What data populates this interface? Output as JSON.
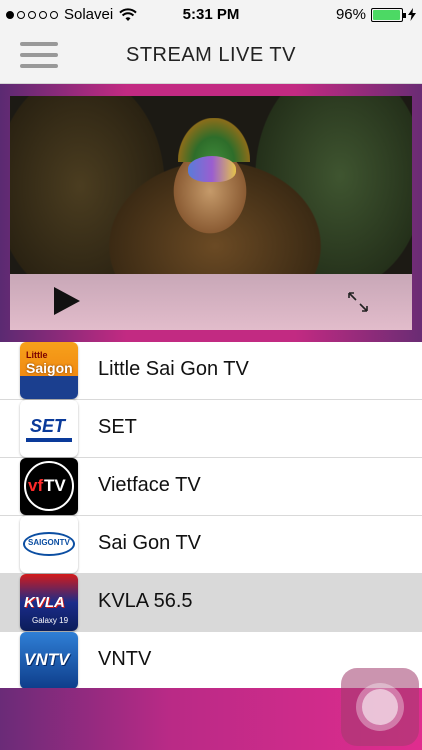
{
  "status_bar": {
    "carrier": "Solavei",
    "time": "5:31 PM",
    "battery": "96%",
    "battery_level": 0.96,
    "signal_bars_filled": 1,
    "signal_bars_total": 5
  },
  "nav": {
    "title": "STREAM LIVE TV",
    "menu_icon": "hamburger-menu-icon"
  },
  "player": {
    "play_icon": "play-icon",
    "expand_icon": "fullscreen-expand-icon"
  },
  "channels": [
    {
      "name": "Little Sai Gon TV",
      "logo_text": [
        "Little",
        "Saigon"
      ],
      "selected": false
    },
    {
      "name": "SET",
      "logo_text": [
        "SET"
      ],
      "selected": false
    },
    {
      "name": "Vietface TV",
      "logo_text": [
        "vf",
        "TV"
      ],
      "selected": false
    },
    {
      "name": "Sai Gon TV",
      "logo_text": [
        "SAIGONTV"
      ],
      "selected": false
    },
    {
      "name": "KVLA 56.5",
      "logo_text": [
        "KVLA",
        "Galaxy 19"
      ],
      "selected": true
    },
    {
      "name": "VNTV",
      "logo_text": [
        "VNTV"
      ],
      "selected": false
    }
  ],
  "colors": {
    "accent_pink": "#e02c8e",
    "accent_purple": "#6a2b78",
    "selected_row": "#d9d9d9"
  }
}
